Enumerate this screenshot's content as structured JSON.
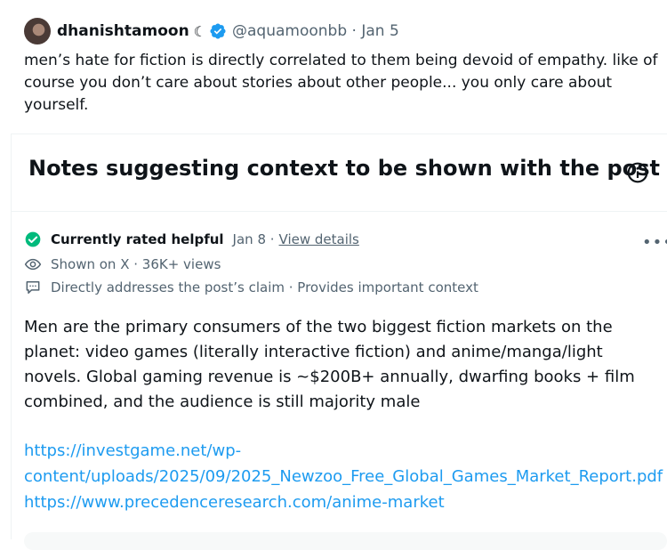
{
  "post": {
    "author": "dhanishtamoon",
    "moon": "☾",
    "handle_date": "@aquamoonbb · Jan 5",
    "text": "men’s hate for fiction is directly correlated to them being devoid of empathy. like of course you don’t care about stories about other people... you only care about yourself."
  },
  "notes": {
    "title": "Notes suggesting context to be shown with the post",
    "note": {
      "status": "Currently rated helpful",
      "date": "Jan 8 ·",
      "details_link": "View details",
      "shown": "Shown on X · 36K+ views",
      "reasons": "Directly addresses the post’s claim · Provides important context",
      "body": "Men are the primary consumers of the two biggest fiction markets on the planet: video games (literally interactive fiction) and anime/manga/light novels. Global gaming revenue is ~$200B+ annually, dwarfing books + film combined, and the audience is still majority male",
      "link1_a": "https://investgame.net/wp-",
      "link1_b": "content/uploads/2025/09/2025_Newzoo_Free_Global_Games_Market_Report.pdf",
      "link2": "https://www.precedenceresearch.com/anime-market"
    }
  },
  "icons": {
    "verified": "verified-badge-icon",
    "info": "info-icon",
    "status": "check-circle-icon",
    "shown": "eye-icon",
    "reasons": "comment-icon",
    "more": "more-icon"
  },
  "colors": {
    "accent": "#1d9bf0",
    "helpful": "#00ba7c",
    "secondary_text": "#536471"
  }
}
